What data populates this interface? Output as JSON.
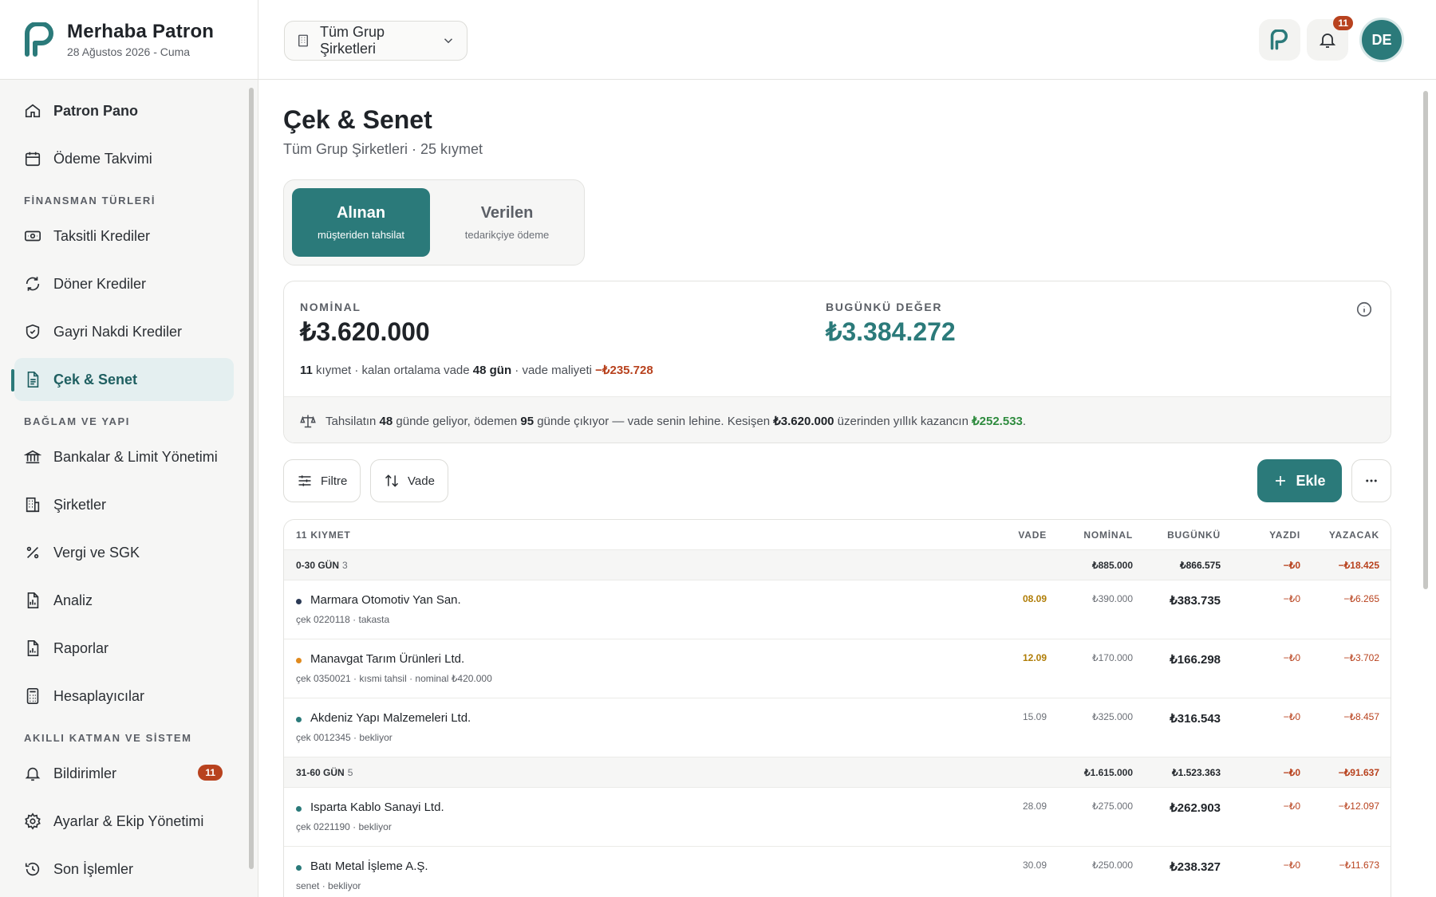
{
  "brand": {
    "title": "Merhaba Patron",
    "date": "28 Ağustos 2026 - Cuma"
  },
  "sidebar": {
    "top_items": [
      {
        "label": "Patron Pano",
        "icon": "home-icon"
      },
      {
        "label": "Ödeme Takvimi",
        "icon": "calendar-icon"
      }
    ],
    "sections": [
      {
        "title": "FİNANSMAN TÜRLERİ",
        "items": [
          {
            "label": "Taksitli Krediler",
            "icon": "banknote-icon"
          },
          {
            "label": "Döner Krediler",
            "icon": "refresh-icon"
          },
          {
            "label": "Gayri Nakdi Krediler",
            "icon": "shield-icon"
          },
          {
            "label": "Çek & Senet",
            "icon": "document-icon",
            "active": true
          }
        ]
      },
      {
        "title": "BAĞLAM VE YAPI",
        "items": [
          {
            "label": "Bankalar & Limit Yönetimi",
            "icon": "bank-icon"
          },
          {
            "label": "Şirketler",
            "icon": "building-icon"
          },
          {
            "label": "Vergi ve SGK",
            "icon": "percent-icon"
          },
          {
            "label": "Analiz",
            "icon": "report-chart-icon"
          },
          {
            "label": "Raporlar",
            "icon": "report-file-icon"
          },
          {
            "label": "Hesaplayıcılar",
            "icon": "calculator-icon"
          }
        ]
      },
      {
        "title": "AKILLI KATMAN VE SİSTEM",
        "items": [
          {
            "label": "Bildirimler",
            "icon": "bell-icon",
            "badge": "11"
          },
          {
            "label": "Ayarlar & Ekip Yönetimi",
            "icon": "gear-icon"
          },
          {
            "label": "Son İşlemler",
            "icon": "history-icon"
          }
        ]
      }
    ]
  },
  "header": {
    "company_select": "Tüm Grup Şirketleri",
    "notif_count": "11",
    "avatar": "DE"
  },
  "page": {
    "title": "Çek & Senet",
    "subtitle": "Tüm Grup Şirketleri · 25 kıymet"
  },
  "segment": {
    "received": {
      "title": "Alınan",
      "sub": "müşteriden tahsilat"
    },
    "given": {
      "title": "Verilen",
      "sub": "tedarikçiye ödeme"
    }
  },
  "summary": {
    "nominal_label": "NOMİNAL",
    "nominal_value": "₺3.620.000",
    "present_label": "BUGÜNKÜ DEĞER",
    "present_value": "₺3.384.272",
    "count": "11",
    "t1": " kıymet · kalan ortalama vade ",
    "avg_days": "48 gün",
    "t2": " · vade maliyeti ",
    "cost": "−₺235.728",
    "note": {
      "a": "Tahsilatın ",
      "b": "48",
      "c": " günde geliyor, ödemen ",
      "d": "95",
      "e": " günde çıkıyor — vade senin lehine. Kesişen ",
      "f": "₺3.620.000",
      "g": " üzerinden yıllık kazancın ",
      "h": "₺252.533",
      "i": "."
    }
  },
  "toolbar": {
    "filter": "Filtre",
    "sort": "Vade",
    "add": "Ekle"
  },
  "table": {
    "headers": {
      "count": "11 KIYMET",
      "vade": "VADE",
      "nominal": "NOMİNAL",
      "bugunku": "BUGÜNKÜ",
      "yazdi": "YAZDI",
      "yazacak": "YAZACAK"
    },
    "group1": {
      "label": "0-30 GÜN",
      "count": "3",
      "nominal": "₺885.000",
      "bugunku": "₺866.575",
      "yazdi": "−₺0",
      "yazacak": "−₺18.425"
    },
    "group2": {
      "label": "31-60 GÜN",
      "count": "5",
      "nominal": "₺1.615.000",
      "bugunku": "₺1.523.363",
      "yazdi": "−₺0",
      "yazacak": "−₺91.637"
    },
    "rows": [
      {
        "name": "Marmara Otomotiv Yan San.",
        "meta": "çek 0220118 · takasta",
        "vade": "08.09",
        "nominal": "₺390.000",
        "bugunku": "₺383.735",
        "yazdi": "−₺0",
        "yazacak": "−₺6.265",
        "dot": "#2b3a55"
      },
      {
        "name": "Manavgat Tarım Ürünleri Ltd.",
        "meta": "çek 0350021 · kısmi tahsil · nominal ₺420.000",
        "vade": "12.09",
        "nominal": "₺170.000",
        "bugunku": "₺166.298",
        "yazdi": "−₺0",
        "yazacak": "−₺3.702",
        "dot": "#e08a1e"
      },
      {
        "name": "Akdeniz Yapı Malzemeleri Ltd.",
        "meta": "çek 0012345 · bekliyor",
        "vade": "15.09",
        "nominal": "₺325.000",
        "bugunku": "₺316.543",
        "yazdi": "−₺0",
        "yazacak": "−₺8.457",
        "dot": "#2b7a7a"
      },
      {
        "name": "Isparta Kablo Sanayi Ltd.",
        "meta": "çek 0221190 · bekliyor",
        "vade": "28.09",
        "nominal": "₺275.000",
        "bugunku": "₺262.903",
        "yazdi": "−₺0",
        "yazacak": "−₺12.097",
        "dot": "#2b7a7a"
      },
      {
        "name": "Batı Metal İşleme A.Ş.",
        "meta": "senet · bekliyor",
        "vade": "30.09",
        "nominal": "₺250.000",
        "bugunku": "₺238.327",
        "yazdi": "−₺0",
        "yazacak": "−₺11.673",
        "dot": "#2b7a7a"
      }
    ]
  },
  "colors": {
    "accent": "#2b7a7a",
    "negative": "#b8421e",
    "positive": "#2e8b3e",
    "warning": "#b07d07"
  }
}
